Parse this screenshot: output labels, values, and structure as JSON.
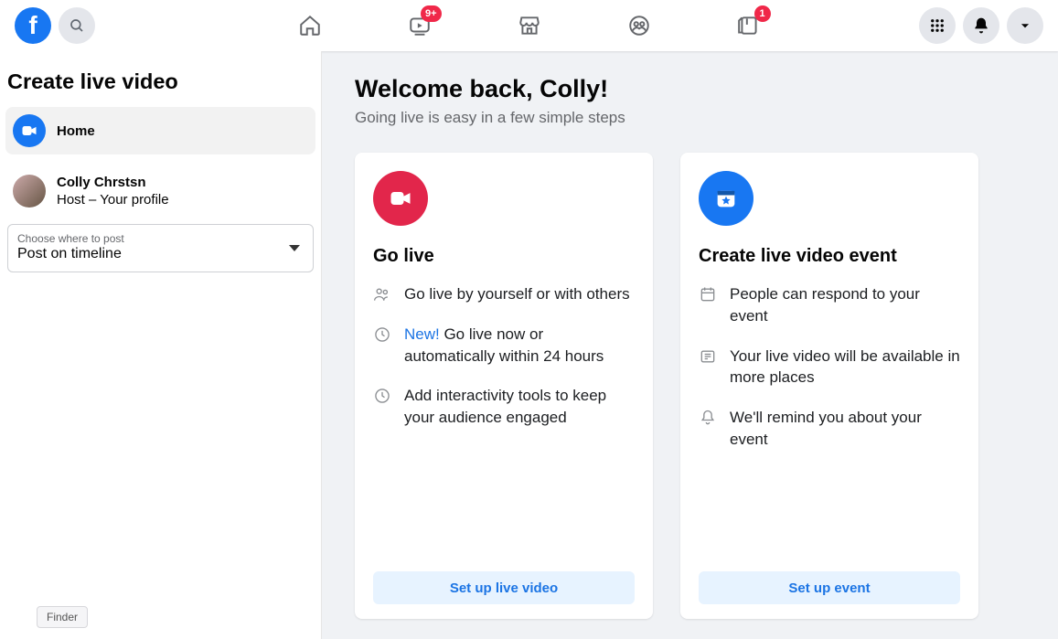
{
  "nav": {
    "watch_badge": "9+",
    "pages_badge": "1"
  },
  "sidebar": {
    "title": "Create live video",
    "home_label": "Home",
    "host": {
      "name": "Colly Chrstsn",
      "subtitle": "Host – Your profile"
    },
    "picker": {
      "label": "Choose where to post",
      "value": "Post on timeline"
    },
    "finder": "Finder"
  },
  "hero": {
    "title": "Welcome back, Colly!",
    "subtitle": "Going live is easy in a few simple steps"
  },
  "cards": {
    "go_live": {
      "title": "Go live",
      "feat1": "Go live by yourself or with others",
      "feat2_new": "New!",
      "feat2_rest": " Go live now or automatically within 24 hours",
      "feat3": "Add interactivity tools to keep your audience engaged",
      "cta": "Set up live video"
    },
    "event": {
      "title": "Create live video event",
      "feat1": "People can respond to your event",
      "feat2": "Your live video will be available in more places",
      "feat3": "We'll remind you about your event",
      "cta": "Set up event"
    }
  }
}
